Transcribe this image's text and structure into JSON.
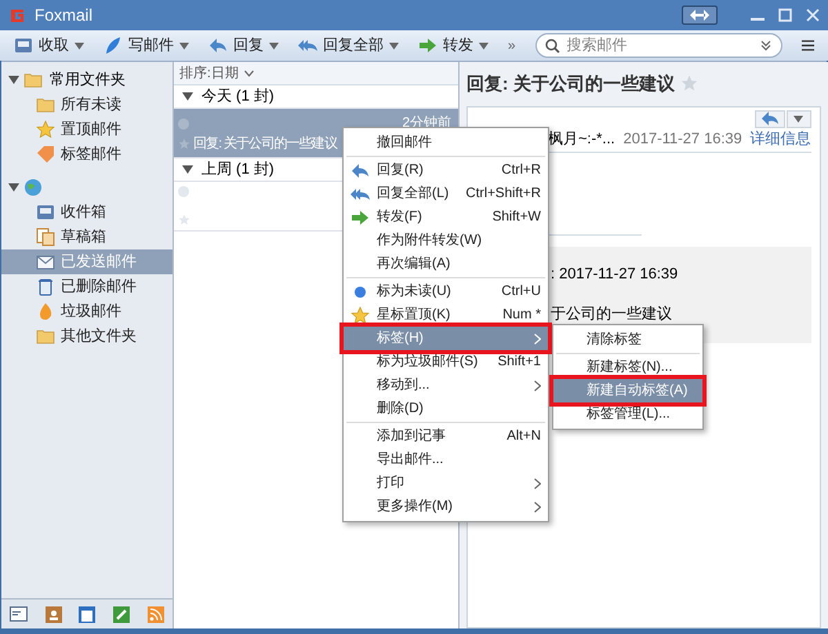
{
  "window": {
    "title": "Foxmail"
  },
  "toolbar": [
    {
      "label": "收取"
    },
    {
      "label": "写邮件"
    },
    {
      "label": "回复"
    },
    {
      "label": "回复全部"
    },
    {
      "label": "转发"
    }
  ],
  "toolbar_more": "»",
  "search": {
    "placeholder": "搜索邮件"
  },
  "sidebar": {
    "groups": [
      {
        "label": "常用文件夹",
        "expanded": true,
        "children": [
          {
            "label": "所有未读",
            "selected": false
          },
          {
            "label": "置顶邮件",
            "selected": false
          },
          {
            "label": "标签邮件",
            "selected": false
          }
        ]
      },
      {
        "expanded": true,
        "children": [
          {
            "label": "收件箱",
            "selected": false
          },
          {
            "label": "草稿箱",
            "selected": false
          },
          {
            "label": "已发送邮件",
            "selected": true
          },
          {
            "label": "已删除邮件",
            "selected": false
          },
          {
            "label": "垃圾邮件",
            "selected": false
          },
          {
            "label": "其他文件夹",
            "selected": false
          }
        ]
      }
    ]
  },
  "message_list": {
    "sort": "排序:日期",
    "groups": [
      {
        "label": "今天 (1 封)",
        "expanded": true,
        "messages": [
          {
            "time": "2分钟前",
            "subject": "回复: 关于公司的一些建议",
            "selected": true
          }
        ]
      },
      {
        "label": "上周 (1 封)",
        "expanded": true,
        "messages": [
          {
            "selected": false
          }
        ]
      }
    ]
  },
  "reading_pane": {
    "subject": "回复: 关于公司的一些建议",
    "sender": "枫月~:-*...",
    "date": "2017-11-27 16:39",
    "details_link": "详细信息",
    "quote_date": ": 2017-11-27 16:39",
    "quote_subject": "于公司的一些建议"
  },
  "context_menu": [
    {
      "kind": "item",
      "label": "撤回邮件",
      "selected": false,
      "annotated": false
    },
    {
      "kind": "separator"
    },
    {
      "kind": "item",
      "label": "回复(R)",
      "shortcut": "Ctrl+R",
      "selected": false,
      "annotated": false
    },
    {
      "kind": "item",
      "label": "回复全部(L)",
      "shortcut": "Ctrl+Shift+R",
      "selected": false,
      "annotated": false
    },
    {
      "kind": "item",
      "label": "转发(F)",
      "shortcut": "Shift+W",
      "selected": false,
      "annotated": false
    },
    {
      "kind": "item",
      "label": "作为附件转发(W)",
      "selected": false,
      "annotated": false
    },
    {
      "kind": "item",
      "label": "再次编辑(A)",
      "selected": false,
      "annotated": false
    },
    {
      "kind": "separator"
    },
    {
      "kind": "item",
      "label": "标为未读(U)",
      "shortcut": "Ctrl+U",
      "selected": false,
      "annotated": false
    },
    {
      "kind": "item",
      "label": "星标置顶(K)",
      "shortcut": "Num *",
      "selected": false,
      "annotated": false
    },
    {
      "kind": "item",
      "label": "标签(H)",
      "submenu": true,
      "selected": true,
      "annotated": true
    },
    {
      "kind": "item",
      "label": "标为垃圾邮件(S)",
      "shortcut": "Shift+1",
      "selected": false,
      "annotated": false
    },
    {
      "kind": "item",
      "label": "移动到...",
      "submenu": true,
      "selected": false,
      "annotated": false
    },
    {
      "kind": "item",
      "label": "删除(D)",
      "selected": false,
      "annotated": false
    },
    {
      "kind": "separator"
    },
    {
      "kind": "item",
      "label": "添加到记事",
      "shortcut": "Alt+N",
      "selected": false,
      "annotated": false
    },
    {
      "kind": "item",
      "label": "导出邮件...",
      "selected": false,
      "annotated": false
    },
    {
      "kind": "item",
      "label": "打印",
      "submenu": true,
      "selected": false,
      "annotated": false
    },
    {
      "kind": "item",
      "label": "更多操作(M)",
      "submenu": true,
      "selected": false,
      "annotated": false
    }
  ],
  "submenu": [
    {
      "kind": "item",
      "label": "清除标签",
      "selected": false,
      "annotated": false
    },
    {
      "kind": "separator"
    },
    {
      "kind": "item",
      "label": "新建标签(N)...",
      "selected": false,
      "annotated": false
    },
    {
      "kind": "item",
      "label": "新建自动标签(A)",
      "selected": true,
      "annotated": true
    },
    {
      "kind": "item",
      "label": "标签管理(L)...",
      "selected": false,
      "annotated": false
    }
  ]
}
